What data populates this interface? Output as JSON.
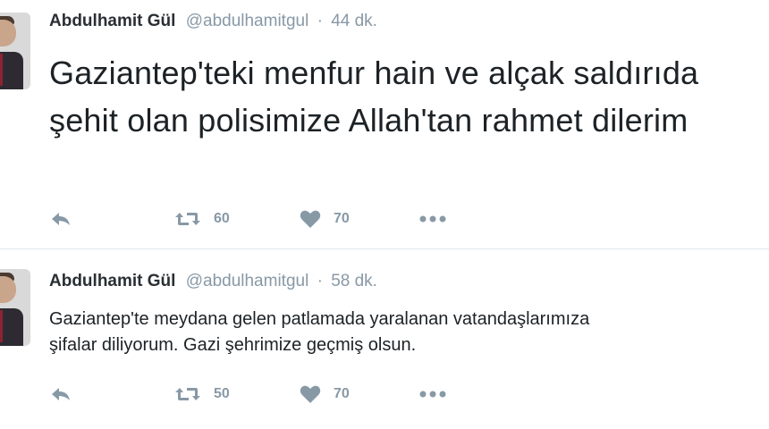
{
  "tweets": [
    {
      "author_name": "Abdulhamit Gül",
      "handle": "@abdulhamitgul",
      "separator": "·",
      "time": "44 dk.",
      "text": "Gaziantep'teki menfur hain ve alçak saldırıda şehit olan polisimize Allah'tan rahmet dilerim",
      "retweets": "60",
      "likes": "70"
    },
    {
      "author_name": "Abdulhamit Gül",
      "handle": "@abdulhamitgul",
      "separator": "·",
      "time": "58 dk.",
      "text": "Gaziantep'te meydana gelen patlamada yaralanan vatandaşlarımıza\nşifalar diliyorum. Gazi şehrimize geçmiş olsun.",
      "retweets": "50",
      "likes": "70"
    }
  ],
  "icons": {
    "reply": "reply-icon",
    "retweet": "retweet-icon",
    "like": "heart-icon",
    "more": "more-icon"
  },
  "colors": {
    "text": "#1c2226",
    "muted": "#8899a6",
    "divider": "#e1e8ed"
  }
}
